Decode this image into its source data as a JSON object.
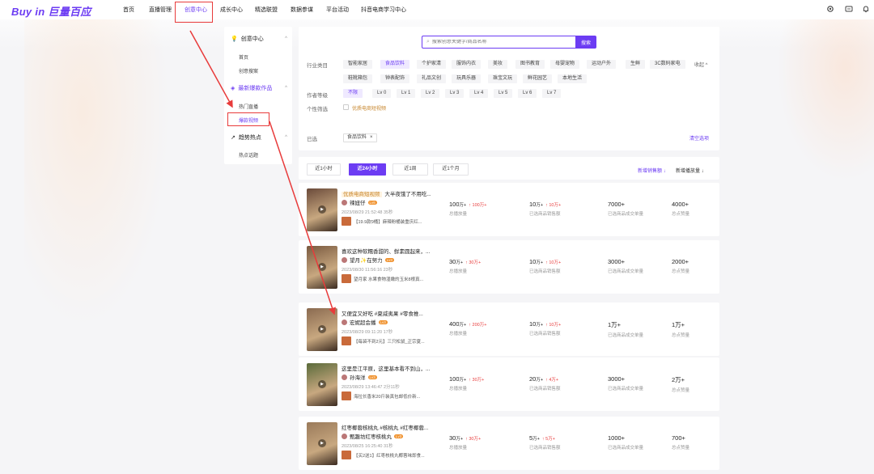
{
  "logo": "Buy in 巨量百应",
  "nav": [
    "首页",
    "直播管理",
    "创意中心",
    "成长中心",
    "精选联盟",
    "数据参谋",
    "平台活动",
    "抖音电商学习中心"
  ],
  "nav_active": 2,
  "top_icons": [
    "gear-icon",
    "message-icon",
    "bell-icon"
  ],
  "sidemenu": {
    "group1": "创意中心",
    "group1_items": [
      "首页",
      "创意搜案"
    ],
    "group2": "最新爆款作品",
    "group2_items": [
      "热门直播",
      "爆款视频"
    ],
    "group3": "趋势热点",
    "group3_items": [
      "热点话题"
    ]
  },
  "search": {
    "placeholder": "搜索创意关键字/商品名称",
    "button": "搜索"
  },
  "filters": {
    "industry_label": "行业类目",
    "industry_row1": [
      "智能家居",
      "食品饮料",
      "个护家清",
      "服饰内衣",
      "美妆",
      "图书教育",
      "母婴宠物",
      "运动户外",
      "生鲜",
      "3C数码家电"
    ],
    "industry_row2": [
      "鞋靴箱包",
      "钟表配饰",
      "礼品文创",
      "玩具乐器",
      "珠宝文玩",
      "鲜花园艺",
      "本地生活"
    ],
    "fold_label": "收起 ^",
    "level_label": "作者等级",
    "levels": [
      "不限",
      "Lv 0",
      "Lv 1",
      "Lv 2",
      "Lv 3",
      "Lv 4",
      "Lv 5",
      "Lv 6",
      "Lv 7"
    ],
    "personal_label": "个性筛选",
    "personal_option": "优质电商短视频",
    "selected_label": "已选",
    "selected_tag": "食品饮料",
    "clear": "清空选项"
  },
  "tabs": [
    "近1小时",
    "近24小时",
    "近1周",
    "近1个月"
  ],
  "tab_active": 1,
  "sorts": [
    "新增销售额 ↓",
    "新增播放量 ↓"
  ],
  "metric_labels": [
    "总播放量",
    "已选商品销售额",
    "已选商品成交单量",
    "总点赞量"
  ],
  "rows": [
    {
      "badge": "优质电商短视频",
      "title": "大半夜饿了不用吃...",
      "author": "辣妞仔",
      "level": "Lv6",
      "time": "2023/08/29 21:52:48  35秒",
      "goods": "【19.9款9桶】麻辣粉桶装重庆红...",
      "m1": "100",
      "m1_unit": "万+",
      "m1_up": "↑ 100万+",
      "m2": "10",
      "m2_unit": "万+",
      "m2_up": "↑ 10万+",
      "m3": "7000+",
      "m4": "4000+",
      "thumb_color": "#6a4a3a"
    },
    {
      "badge": "",
      "title": "喜欢这种软糯香甜的、鲜素圆起来，...",
      "author": "望月✨在努力",
      "level": "Lv3",
      "time": "2023/08/30 11:56:16  23秒",
      "goods": "望月家 水果食物湿嫩的玉米8根真...",
      "m1": "30",
      "m1_unit": "万+",
      "m1_up": "↑ 30万+",
      "m2": "10",
      "m2_unit": "万+",
      "m2_up": "↑ 10万+",
      "m3": "3000+",
      "m4": "2000+",
      "thumb_color": "#7a5a40"
    },
    {
      "badge": "",
      "title": "又便宜又好吃 #夏威夷果 #零食推...",
      "author": "宏妮超会播",
      "level": "Lv3",
      "time": "2023/08/29 09:11:20  17秒",
      "goods": "【每袋不到2元】三只松鼠_正宗夏...",
      "m1": "400",
      "m1_unit": "万+",
      "m1_up": "↑ 200万+",
      "m2": "10",
      "m2_unit": "万+",
      "m2_up": "↑ 10万+",
      "m3": "1万+",
      "m4": "1万+",
      "thumb_color": "#8a6a50"
    },
    {
      "badge": "",
      "title": "这里是江平原，这里基本看不到山，...",
      "author": "孙海洋",
      "level": "Lv3",
      "time": "2023/08/29 13:46:47  2分11秒",
      "goods": "海拉长香米20斤装真包邮低价新...",
      "m1": "100",
      "m1_unit": "万+",
      "m1_up": "↑ 30万+",
      "m2": "20",
      "m2_unit": "万+",
      "m2_up": "↑ 4万+",
      "m3": "3000+",
      "m4": "2万+",
      "thumb_color": "#5a6a3a"
    },
    {
      "badge": "",
      "title": "红枣椰蓉核桃丸 #核桃丸 #红枣椰蓉...",
      "author": "甄趣坊红枣核桃丸",
      "level": "Lv3",
      "time": "2023/08/25 16:25:40  31秒",
      "goods": "【买2送1】红枣核桃丸椰蓉味即食...",
      "m1": "30",
      "m1_unit": "万+",
      "m1_up": "↑ 30万+",
      "m2": "5",
      "m2_unit": "万+",
      "m2_up": "↑ 5万+",
      "m3": "1000+",
      "m4": "700+",
      "thumb_color": "#9a7a5a"
    }
  ],
  "colors": {
    "accent": "#6c3cf3",
    "annotation": "#e83b3b"
  }
}
